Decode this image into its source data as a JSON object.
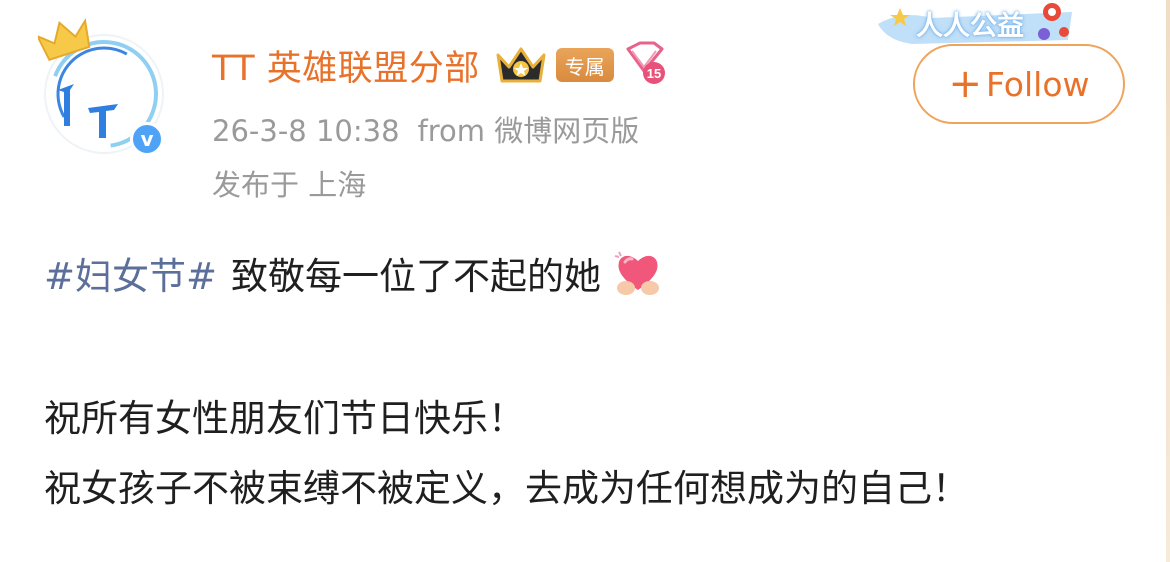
{
  "user": {
    "name": "TT 英雄联盟分部",
    "exclusive_badge": "专属",
    "level": "15",
    "verified_mark": "v"
  },
  "post_meta": {
    "date": "26-3-8 10:38",
    "source": "from 微博网页版",
    "location": "发布于 上海"
  },
  "banner": {
    "text": "人人公益"
  },
  "follow": {
    "plus": "+",
    "label": "Follow"
  },
  "post": {
    "hashtag": "#妇女节#",
    "line1": "致敬每一位了不起的她",
    "line2": "祝所有女性朋友们节日快乐！",
    "line3": "祝女孩子不被束缚不被定义，去成为任何想成为的自己！"
  },
  "colors": {
    "username": "#e8722a",
    "hashtag": "#5b6f9a",
    "meta": "#9a9a9a",
    "follow_border": "#f0a35a"
  },
  "icons": [
    "crown-icon",
    "verified-icon",
    "vip-crown-icon",
    "level-diamond-icon",
    "heart-hands-icon",
    "plus-icon"
  ]
}
